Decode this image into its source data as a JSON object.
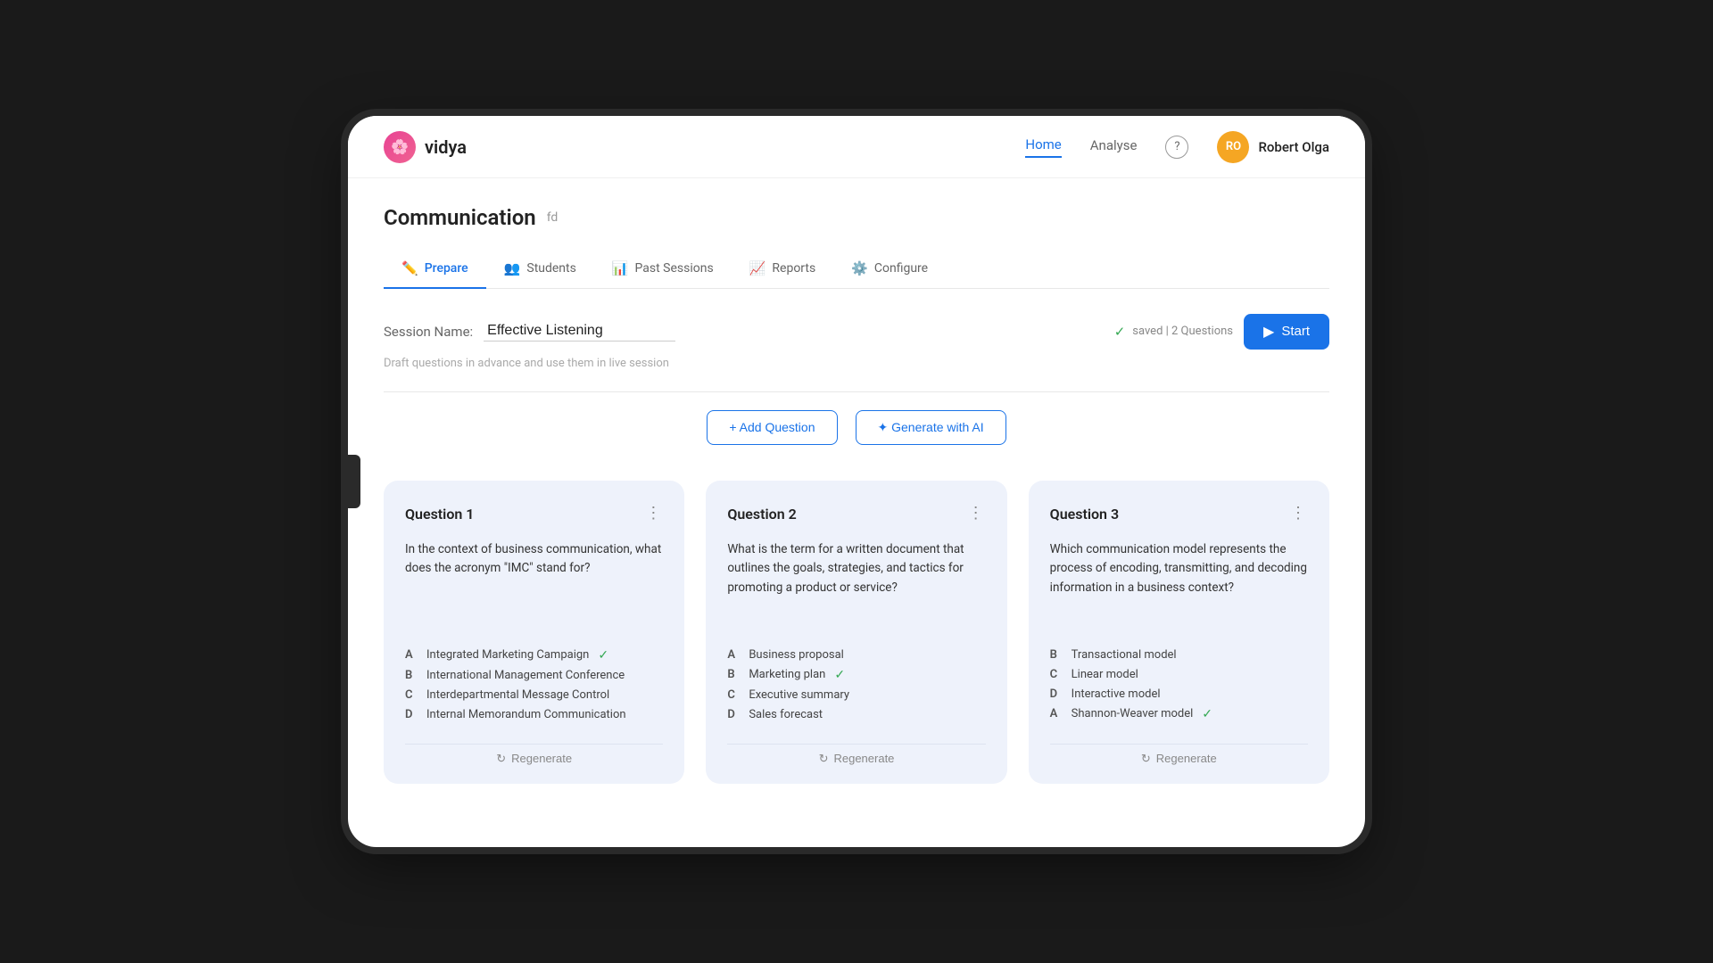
{
  "app": {
    "logo_text": "vidya",
    "logo_initials": "🌸"
  },
  "nav": {
    "links": [
      {
        "label": "Home",
        "active": true
      },
      {
        "label": "Analyse",
        "active": false
      }
    ],
    "help_title": "?",
    "user_name": "Robert Olga",
    "user_initials": "RO"
  },
  "page": {
    "title": "Communication",
    "tag": "fd"
  },
  "tabs": [
    {
      "label": "Prepare",
      "icon": "✏️",
      "active": true
    },
    {
      "label": "Students",
      "icon": "👥",
      "active": false
    },
    {
      "label": "Past Sessions",
      "icon": "📊",
      "active": false
    },
    {
      "label": "Reports",
      "icon": "📈",
      "active": false
    },
    {
      "label": "Configure",
      "icon": "⚙️",
      "active": false
    }
  ],
  "session": {
    "label": "Session Name:",
    "name": "Effective Listening",
    "status": "saved | 2 Questions",
    "start_label": "Start"
  },
  "draft_hint": "Draft questions in advance and use them in live session",
  "actions": {
    "add_question": "+ Add Question",
    "generate_ai": "✦ Generate with AI"
  },
  "questions": [
    {
      "title": "Question 1",
      "text": "In the context of business communication, what does the acronym \"IMC\" stand for?",
      "options": [
        {
          "letter": "A",
          "text": "Integrated Marketing Campaign",
          "correct": true
        },
        {
          "letter": "B",
          "text": "International Management Conference",
          "correct": false
        },
        {
          "letter": "C",
          "text": "Interdepartmental Message Control",
          "correct": false
        },
        {
          "letter": "D",
          "text": "Internal Memorandum Communication",
          "correct": false
        }
      ],
      "regenerate_label": "Regenerate"
    },
    {
      "title": "Question 2",
      "text": "What is the term for a written document that outlines the goals, strategies, and tactics for promoting a product or service?",
      "options": [
        {
          "letter": "A",
          "text": "Business proposal",
          "correct": false
        },
        {
          "letter": "B",
          "text": "Marketing plan",
          "correct": true
        },
        {
          "letter": "C",
          "text": "Executive summary",
          "correct": false
        },
        {
          "letter": "D",
          "text": "Sales forecast",
          "correct": false
        }
      ],
      "regenerate_label": "Regenerate"
    },
    {
      "title": "Question 3",
      "text": "Which communication model represents the process of encoding, transmitting, and decoding information in a business context?",
      "options": [
        {
          "letter": "B",
          "text": "Transactional model",
          "correct": false
        },
        {
          "letter": "C",
          "text": "Linear model",
          "correct": false
        },
        {
          "letter": "D",
          "text": "Interactive model",
          "correct": false
        },
        {
          "letter": "A",
          "text": "Shannon-Weaver model",
          "correct": true
        }
      ],
      "regenerate_label": "Regenerate"
    }
  ]
}
